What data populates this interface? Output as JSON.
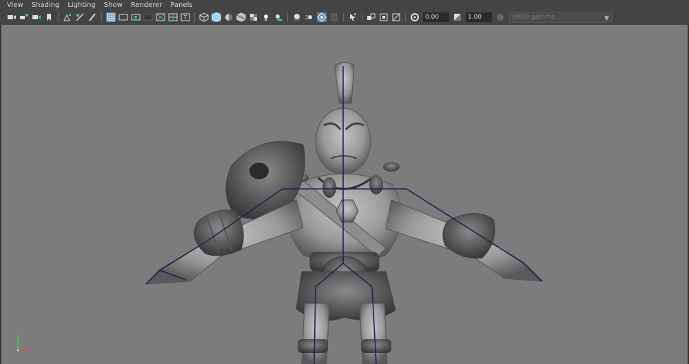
{
  "menubar": {
    "items": [
      "View",
      "Shading",
      "Lighting",
      "Show",
      "Renderer",
      "Panels"
    ]
  },
  "toolbar": {
    "exposure_value": "0.00",
    "gamma_value": "1.00",
    "color_space": "sRGB gamma",
    "icons": [
      "camera-icon",
      "camera-attributes-icon",
      "bookmark-icon",
      "image-plane-icon",
      "grid-icon",
      "film-gate-icon",
      "resolution-gate-icon",
      "gate-mask-icon",
      "field-chart-icon",
      "safe-title-icon",
      "wireframe-icon",
      "smooth-shade-icon",
      "default-material-icon",
      "wireframe-on-shaded-icon",
      "textured-icon",
      "lights-icon",
      "shadows-icon",
      "ambient-occlusion-icon",
      "motion-blur-icon",
      "xray-icon",
      "isolate-select-icon",
      "camera-select-icon",
      "toggle-hud-icon",
      "film-back-icon",
      "exposure-icon",
      "gamma-icon",
      "color-management-icon"
    ]
  },
  "viewport": {
    "background": "#7c7c7c",
    "skeleton_color": "#2e1a52",
    "model_color": "#9a9a9a"
  },
  "axis_gizmo": {
    "x_color": "#e04a4a",
    "y_color": "#4ad04a",
    "z_color": "#4a6ae0"
  }
}
